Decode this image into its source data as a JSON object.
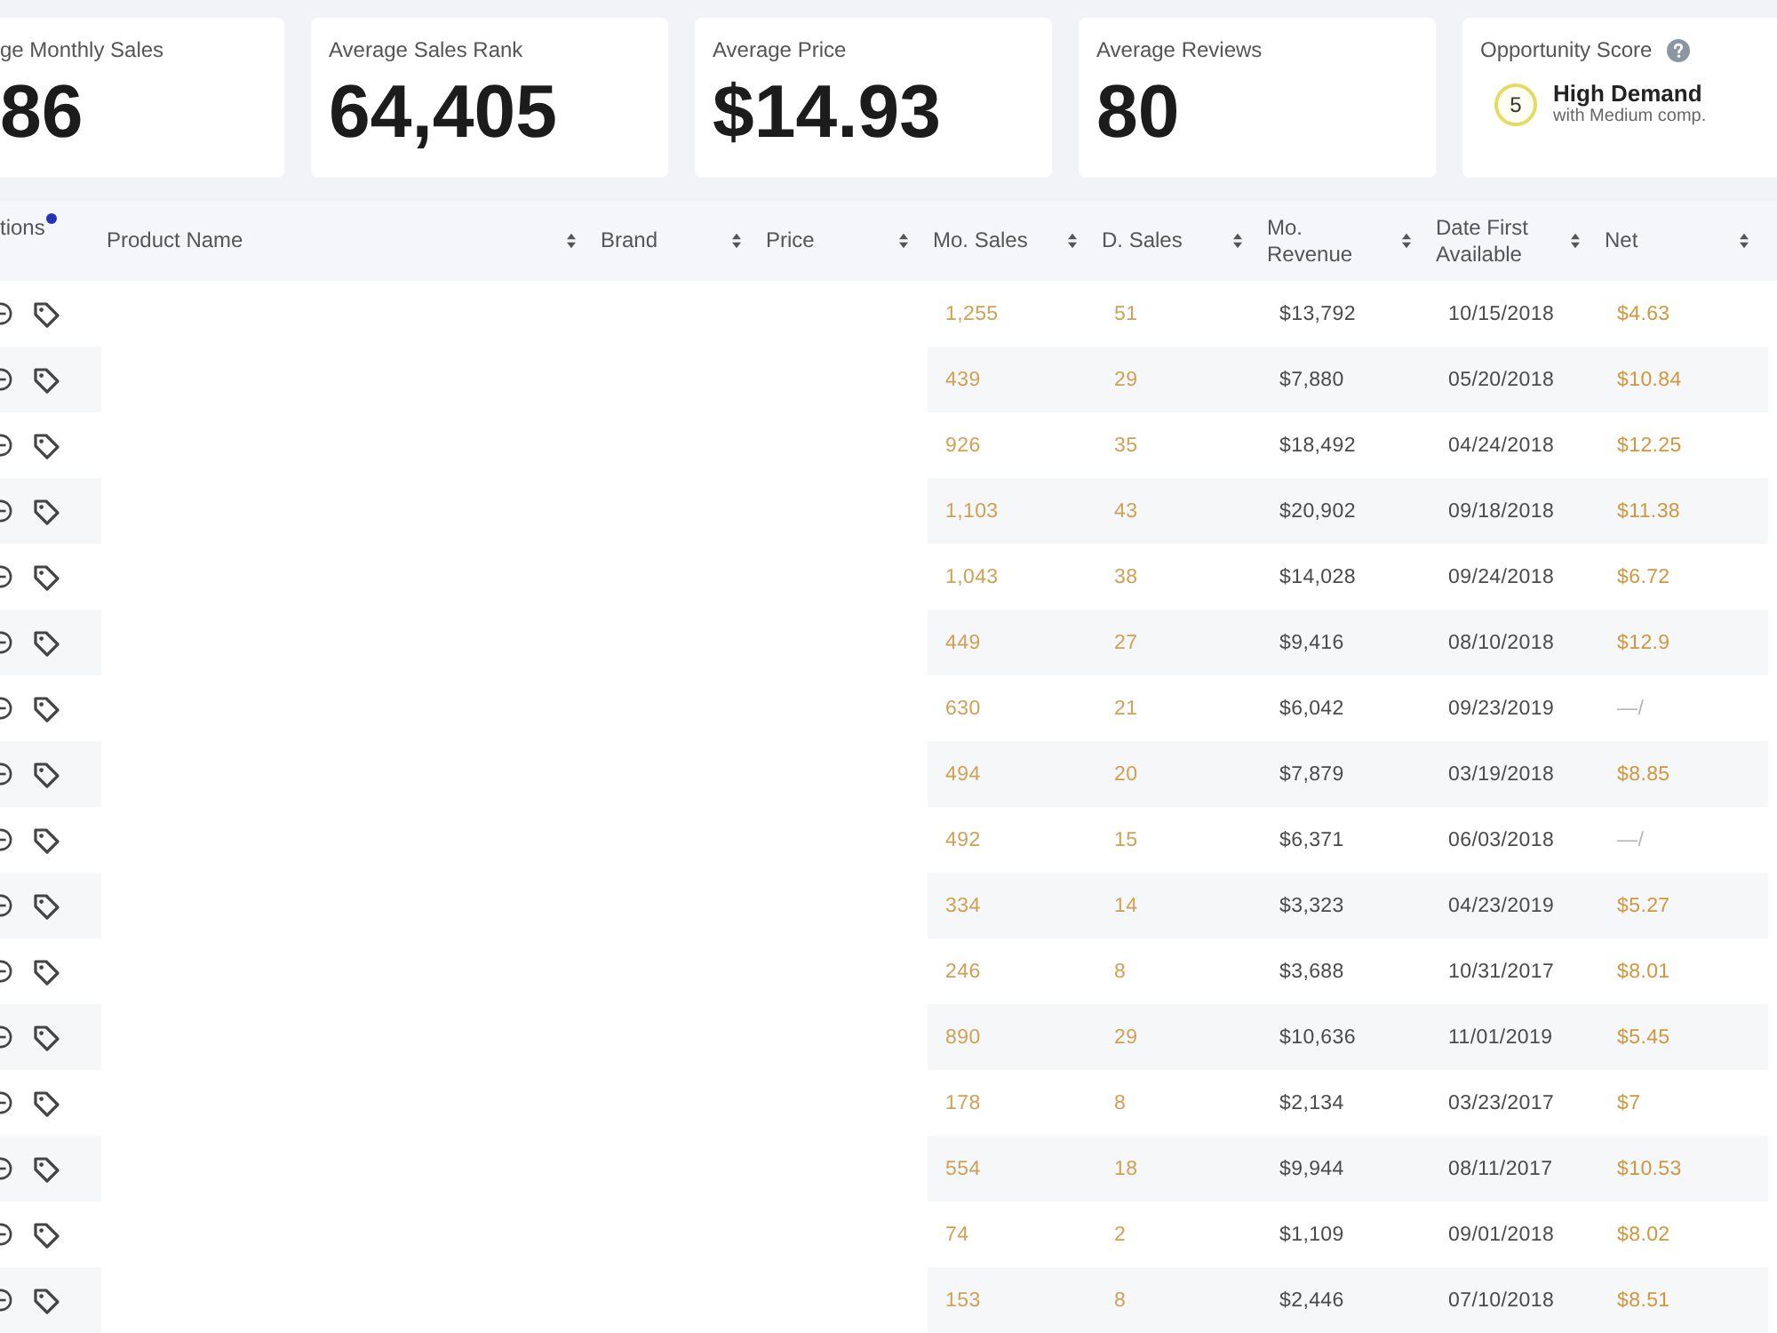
{
  "summary_cards": [
    {
      "label": "ge Monthly Sales",
      "value": "86",
      "cut": true
    },
    {
      "label": "Average Sales Rank",
      "value": "64,405",
      "cut": false
    },
    {
      "label": "Average Price",
      "value": "$14.93",
      "cut": false
    },
    {
      "label": "Average Reviews",
      "value": "80",
      "cut": false
    }
  ],
  "opportunity_score": {
    "label": "Opportunity Score",
    "score": "5",
    "title": "High Demand",
    "subtitle": "with Medium comp."
  },
  "table": {
    "columns": [
      {
        "label": "tions",
        "sortable": false,
        "dot": true
      },
      {
        "label": "Product Name",
        "sortable": true,
        "dot": false
      },
      {
        "label": "Brand",
        "sortable": true,
        "dot": false
      },
      {
        "label": "Price",
        "sortable": true,
        "dot": false
      },
      {
        "label": "Mo. Sales",
        "sortable": true,
        "dot": false
      },
      {
        "label": "D. Sales",
        "sortable": true,
        "dot": false
      },
      {
        "label": "Mo. Revenue",
        "sortable": true,
        "dot": false
      },
      {
        "label": "Date First Available",
        "sortable": true,
        "dot": false
      },
      {
        "label": "Net",
        "sortable": true,
        "dot": false
      }
    ],
    "rows": [
      {
        "mo_sales": "1,255",
        "d_sales": "51",
        "mo_revenue": "$13,792",
        "date_first_available": "10/15/2018",
        "net": {
          "kind": "value",
          "text": "$4.63"
        }
      },
      {
        "mo_sales": "439",
        "d_sales": "29",
        "mo_revenue": "$7,880",
        "date_first_available": "05/20/2018",
        "net": {
          "kind": "value",
          "text": "$10.84"
        }
      },
      {
        "mo_sales": "926",
        "d_sales": "35",
        "mo_revenue": "$18,492",
        "date_first_available": "04/24/2018",
        "net": {
          "kind": "value",
          "text": "$12.25"
        }
      },
      {
        "mo_sales": "1,103",
        "d_sales": "43",
        "mo_revenue": "$20,902",
        "date_first_available": "09/18/2018",
        "net": {
          "kind": "value",
          "text": "$11.38"
        }
      },
      {
        "mo_sales": "1,043",
        "d_sales": "38",
        "mo_revenue": "$14,028",
        "date_first_available": "09/24/2018",
        "net": {
          "kind": "value",
          "text": "$6.72"
        }
      },
      {
        "mo_sales": "449",
        "d_sales": "27",
        "mo_revenue": "$9,416",
        "date_first_available": "08/10/2018",
        "net": {
          "kind": "value",
          "text": "$12.9"
        }
      },
      {
        "mo_sales": "630",
        "d_sales": "21",
        "mo_revenue": "$6,042",
        "date_first_available": "09/23/2019",
        "net": {
          "kind": "empty",
          "text": "—/"
        }
      },
      {
        "mo_sales": "494",
        "d_sales": "20",
        "mo_revenue": "$7,879",
        "date_first_available": "03/19/2018",
        "net": {
          "kind": "value",
          "text": "$8.85"
        }
      },
      {
        "mo_sales": "492",
        "d_sales": "15",
        "mo_revenue": "$6,371",
        "date_first_available": "06/03/2018",
        "net": {
          "kind": "empty",
          "text": "—/"
        }
      },
      {
        "mo_sales": "334",
        "d_sales": "14",
        "mo_revenue": "$3,323",
        "date_first_available": "04/23/2019",
        "net": {
          "kind": "value",
          "text": "$5.27"
        }
      },
      {
        "mo_sales": "246",
        "d_sales": "8",
        "mo_revenue": "$3,688",
        "date_first_available": "10/31/2017",
        "net": {
          "kind": "value",
          "text": "$8.01"
        }
      },
      {
        "mo_sales": "890",
        "d_sales": "29",
        "mo_revenue": "$10,636",
        "date_first_available": "11/01/2019",
        "net": {
          "kind": "value",
          "text": "$5.45"
        }
      },
      {
        "mo_sales": "178",
        "d_sales": "8",
        "mo_revenue": "$2,134",
        "date_first_available": "03/23/2017",
        "net": {
          "kind": "value",
          "text": "$7"
        }
      },
      {
        "mo_sales": "554",
        "d_sales": "18",
        "mo_revenue": "$9,944",
        "date_first_available": "08/11/2017",
        "net": {
          "kind": "value",
          "text": "$10.53"
        }
      },
      {
        "mo_sales": "74",
        "d_sales": "2",
        "mo_revenue": "$1,109",
        "date_first_available": "09/01/2018",
        "net": {
          "kind": "value",
          "text": "$8.02"
        }
      },
      {
        "mo_sales": "153",
        "d_sales": "8",
        "mo_revenue": "$2,446",
        "date_first_available": "07/10/2018",
        "net": {
          "kind": "value",
          "text": "$8.51"
        }
      }
    ]
  }
}
